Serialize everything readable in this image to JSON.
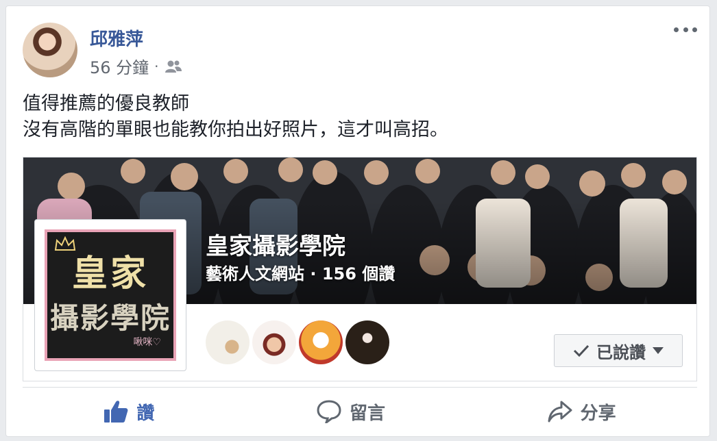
{
  "post": {
    "author": "邱雅萍",
    "time": "56 分鐘",
    "separator": "·",
    "audience_icon": "friends-icon",
    "more_icon": "more-options-icon",
    "text_lines": [
      "值得推薦的優良教師",
      "沒有高階的單眼也能教你拍出好照片，這才叫高招。"
    ]
  },
  "shared_page": {
    "name": "皇家攝影學院",
    "subtitle": "藝術人文網站 · 156 個讚",
    "thumb": {
      "line1": "皇家",
      "line2": "攝影學院",
      "signature": "啾咪♡"
    },
    "liked_button": "已說讚",
    "friend_avatars": [
      "friend-avatar-1",
      "friend-avatar-2",
      "friend-avatar-3",
      "friend-avatar-4"
    ]
  },
  "actions": {
    "like": "讚",
    "comment": "留言",
    "share": "分享"
  },
  "colors": {
    "brand": "#385898",
    "like": "#4267b2",
    "muted": "#606770"
  }
}
